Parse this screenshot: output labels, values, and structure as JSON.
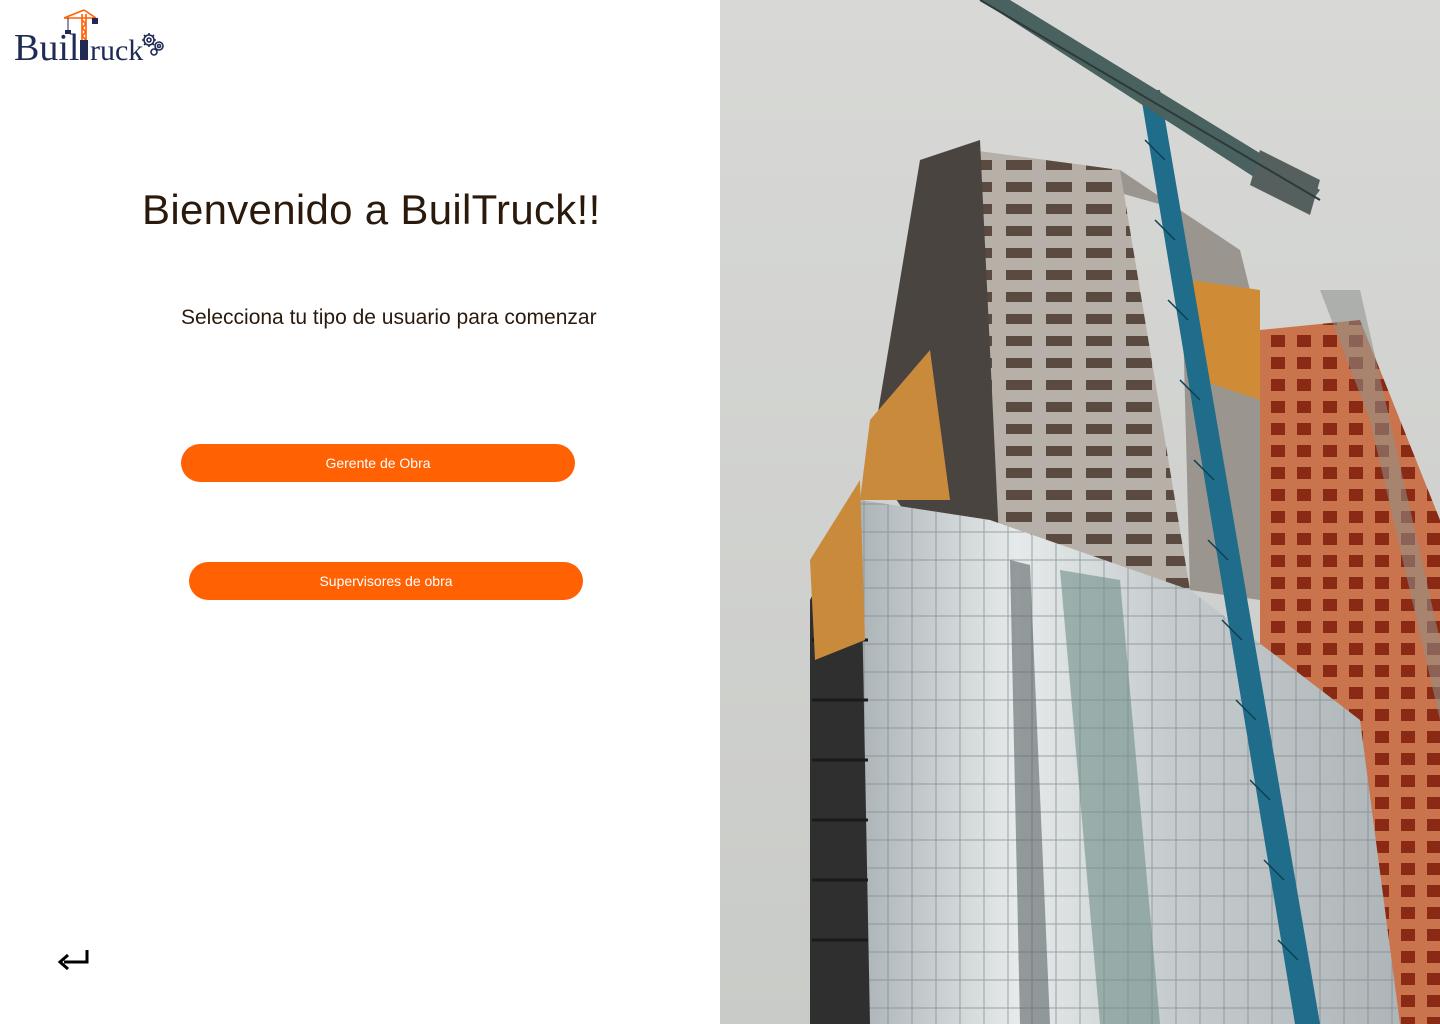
{
  "brand": {
    "name": "BuilTruck",
    "logo_text_left": "Buil",
    "logo_text_right": "ruck",
    "navy": "#1f2a55",
    "accent": "#ff6103"
  },
  "welcome": {
    "title": "Bienvenido a BuilTruck!!",
    "subtitle": "Selecciona tu tipo de usuario para comenzar"
  },
  "roles": {
    "gerente_label": "Gerente de Obra",
    "supervisor_label": "Supervisores de obra"
  },
  "navigation": {
    "back_icon": "return-arrow-icon"
  },
  "hero": {
    "icon": "construction-building-photo"
  }
}
